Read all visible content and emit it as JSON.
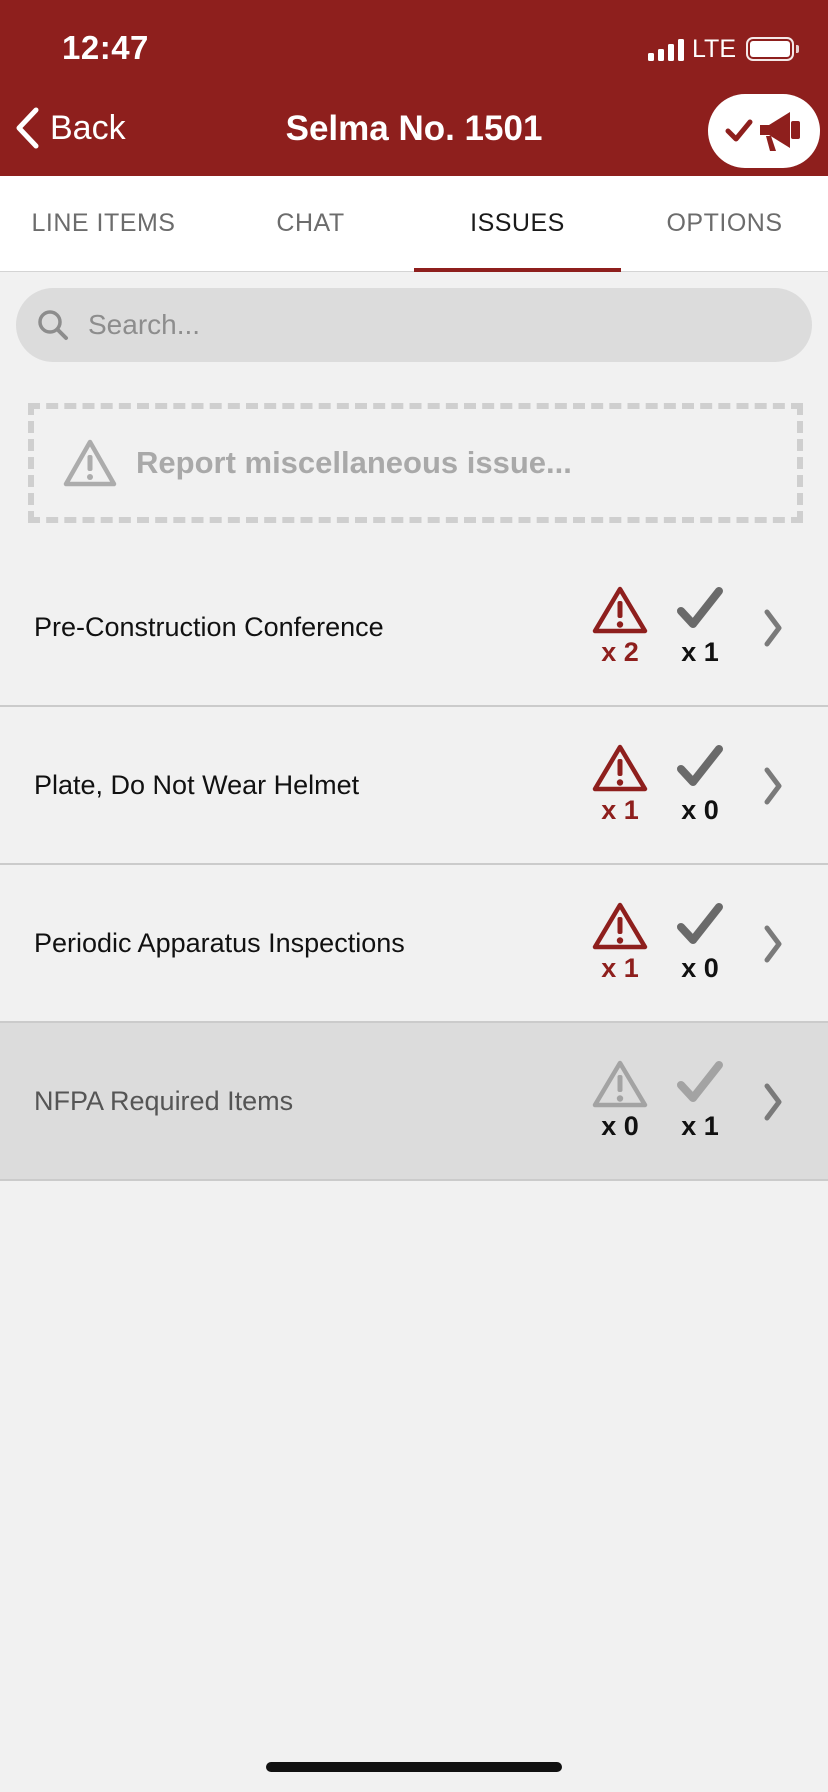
{
  "status_bar": {
    "time": "12:47",
    "network": "LTE"
  },
  "nav": {
    "back_label": "Back",
    "title": "Selma No. 1501",
    "action_icons": [
      "checkmark-icon",
      "megaphone-icon"
    ]
  },
  "tabs": [
    {
      "label": "LINE ITEMS",
      "active": false
    },
    {
      "label": "CHAT",
      "active": false
    },
    {
      "label": "ISSUES",
      "active": true
    },
    {
      "label": "OPTIONS",
      "active": false
    }
  ],
  "search": {
    "placeholder": "Search...",
    "value": ""
  },
  "report": {
    "label": "Report miscellaneous issue..."
  },
  "items": [
    {
      "label": "Pre-Construction Conference",
      "issues": "x 2",
      "completed": "x 1",
      "active": true
    },
    {
      "label": "Plate, Do Not Wear Helmet",
      "issues": "x 1",
      "completed": "x 0",
      "active": true
    },
    {
      "label": "Periodic Apparatus Inspections",
      "issues": "x 1",
      "completed": "x 0",
      "active": true
    },
    {
      "label": "NFPA Required Items",
      "issues": "x 0",
      "completed": "x 1",
      "active": false
    }
  ],
  "colors": {
    "brand": "#8e1f1d",
    "background": "#f1f1f1",
    "dimmed_row": "#dcdcdc"
  }
}
